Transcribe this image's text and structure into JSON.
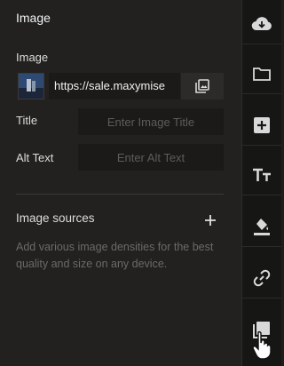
{
  "panel": {
    "title": "Image",
    "image_label": "Image",
    "image_url": "https://sale.maxymise",
    "title_label": "Title",
    "title_placeholder": "Enter Image Title",
    "alt_label": "Alt Text",
    "alt_placeholder": "Enter Alt Text",
    "sources_label": "Image sources",
    "sources_help": "Add various image densities for the best quality and size on any device."
  },
  "sidebar": {
    "items": [
      {
        "icon": "cloud-download-icon"
      },
      {
        "icon": "folder-icon"
      },
      {
        "icon": "plus-square-icon"
      },
      {
        "icon": "text-size-icon"
      },
      {
        "icon": "paint-bucket-icon"
      },
      {
        "icon": "link-icon"
      },
      {
        "icon": "image-crop-icon"
      }
    ]
  },
  "colors": {
    "panel_bg": "#222120",
    "sidebar_bg": "#161615",
    "icon": "#d9d9d9"
  }
}
